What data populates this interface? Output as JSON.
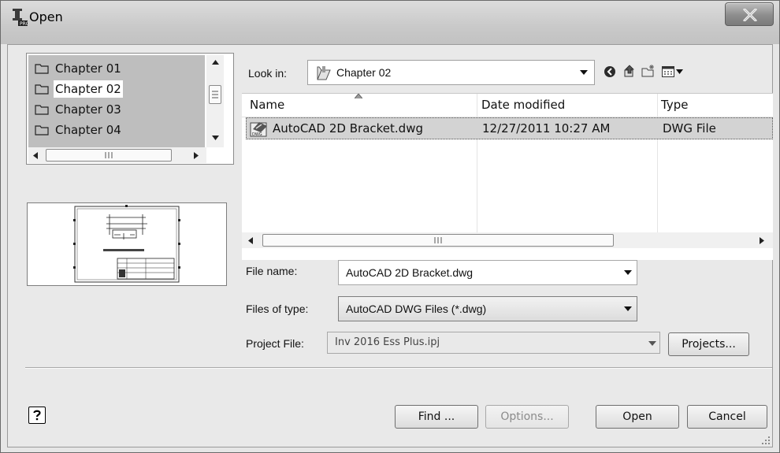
{
  "window": {
    "title": "Open"
  },
  "tree": {
    "items": [
      {
        "label": "Chapter 01",
        "selected": false
      },
      {
        "label": "Chapter 02",
        "selected": true
      },
      {
        "label": "Chapter 03",
        "selected": false
      },
      {
        "label": "Chapter 04",
        "selected": false
      }
    ]
  },
  "lookin": {
    "label": "Look in:",
    "value": "Chapter 02"
  },
  "toolbar": {
    "icons": [
      "back-icon",
      "up-folder-icon",
      "new-folder-icon",
      "views-menu-icon"
    ]
  },
  "file_list": {
    "columns": [
      "Name",
      "Date modified",
      "Type"
    ],
    "rows": [
      {
        "name": "AutoCAD 2D Bracket.dwg",
        "date": "12/27/2011 10:27 AM",
        "type": "DWG File"
      }
    ]
  },
  "form": {
    "file_name_label": "File name:",
    "file_name_value": "AutoCAD 2D Bracket.dwg",
    "files_of_type_label": "Files of type:",
    "files_of_type_value": "AutoCAD DWG Files (*.dwg)",
    "project_file_label": "Project File:",
    "project_file_value": "Inv 2016 Ess Plus.ipj"
  },
  "buttons": {
    "projects": "Projects...",
    "find": "Find ...",
    "options": "Options...",
    "open": "Open",
    "cancel": "Cancel"
  },
  "colors": {
    "selection": "#d3d3d3",
    "tree_background": "#bebebe",
    "dialog": "#e9e9e9"
  }
}
